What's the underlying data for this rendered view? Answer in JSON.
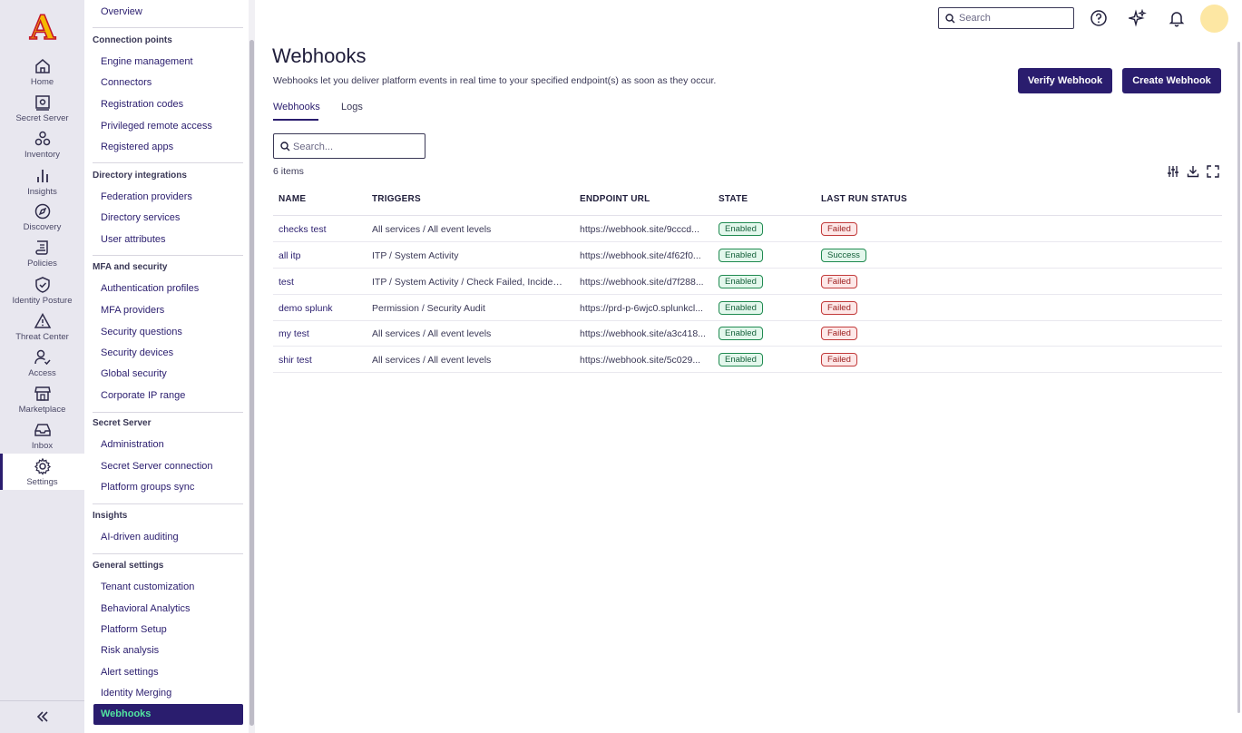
{
  "app": {
    "logo_letter": "A"
  },
  "colors": {
    "accent": "#2a1d6e",
    "active_text": "#52e5a0",
    "success": "#1f8a50",
    "failed": "#c23a3a"
  },
  "rail": {
    "items": [
      {
        "label": "Home",
        "icon": "home-icon"
      },
      {
        "label": "Secret Server",
        "icon": "vault-icon"
      },
      {
        "label": "Inventory",
        "icon": "inventory-icon"
      },
      {
        "label": "Insights",
        "icon": "bar-chart-icon"
      },
      {
        "label": "Discovery",
        "icon": "compass-icon"
      },
      {
        "label": "Policies",
        "icon": "scroll-icon"
      },
      {
        "label": "Identity Posture",
        "icon": "shield-check-icon"
      },
      {
        "label": "Threat Center",
        "icon": "warning-icon"
      },
      {
        "label": "Access",
        "icon": "user-check-icon"
      },
      {
        "label": "Marketplace",
        "icon": "store-icon"
      },
      {
        "label": "Inbox",
        "icon": "inbox-icon"
      },
      {
        "label": "Settings",
        "icon": "gear-icon",
        "active": true
      }
    ]
  },
  "sidenav": {
    "overview": "Overview",
    "sections": [
      {
        "title": "Connection points",
        "items": [
          "Engine management",
          "Connectors",
          "Registration codes",
          "Privileged remote access",
          "Registered apps"
        ]
      },
      {
        "title": "Directory integrations",
        "items": [
          "Federation providers",
          "Directory services",
          "User attributes"
        ]
      },
      {
        "title": "MFA and security",
        "items": [
          "Authentication profiles",
          "MFA providers",
          "Security questions",
          "Security devices",
          "Global security",
          "Corporate IP range"
        ]
      },
      {
        "title": "Secret Server",
        "items": [
          "Administration",
          "Secret Server connection",
          "Platform groups sync"
        ]
      },
      {
        "title": "Insights",
        "items": [
          "AI-driven auditing"
        ]
      },
      {
        "title": "General settings",
        "items": [
          "Tenant customization",
          "Behavioral Analytics",
          "Platform Setup",
          "Risk analysis",
          "Alert settings",
          "Identity Merging"
        ]
      }
    ],
    "active": "Webhooks"
  },
  "topbar": {
    "search_placeholder": "Search"
  },
  "main": {
    "title": "Webhooks",
    "description": "Webhooks let you deliver platform events in real time to your specified endpoint(s) as soon as they occur.",
    "verify_button": "Verify Webhook",
    "create_button": "Create Webhook",
    "tabs": [
      "Webhooks",
      "Logs"
    ],
    "search_placeholder": "Search...",
    "item_count": "6 items"
  },
  "table": {
    "columns": [
      "NAME",
      "TRIGGERS",
      "ENDPOINT URL",
      "STATE",
      "LAST RUN STATUS"
    ],
    "rows": [
      {
        "name": "checks test",
        "triggers": "All services / All event levels",
        "url": "https://webhook.site/9cccd...",
        "state": "Enabled",
        "status": "Failed"
      },
      {
        "name": "all itp",
        "triggers": "ITP / System Activity",
        "url": "https://webhook.site/4f62f0...",
        "state": "Enabled",
        "status": "Success"
      },
      {
        "name": "test",
        "triggers": "ITP / System Activity / Check Failed, Incident ...",
        "url": "https://webhook.site/d7f288...",
        "state": "Enabled",
        "status": "Failed"
      },
      {
        "name": "demo splunk",
        "triggers": "Permission / Security Audit",
        "url": "https://prd-p-6wjc0.splunkcl...",
        "state": "Enabled",
        "status": "Failed"
      },
      {
        "name": "my test",
        "triggers": "All services / All event levels",
        "url": "https://webhook.site/a3c418...",
        "state": "Enabled",
        "status": "Failed"
      },
      {
        "name": "shir test",
        "triggers": "All services / All event levels",
        "url": "https://webhook.site/5c029...",
        "state": "Enabled",
        "status": "Failed"
      }
    ]
  }
}
